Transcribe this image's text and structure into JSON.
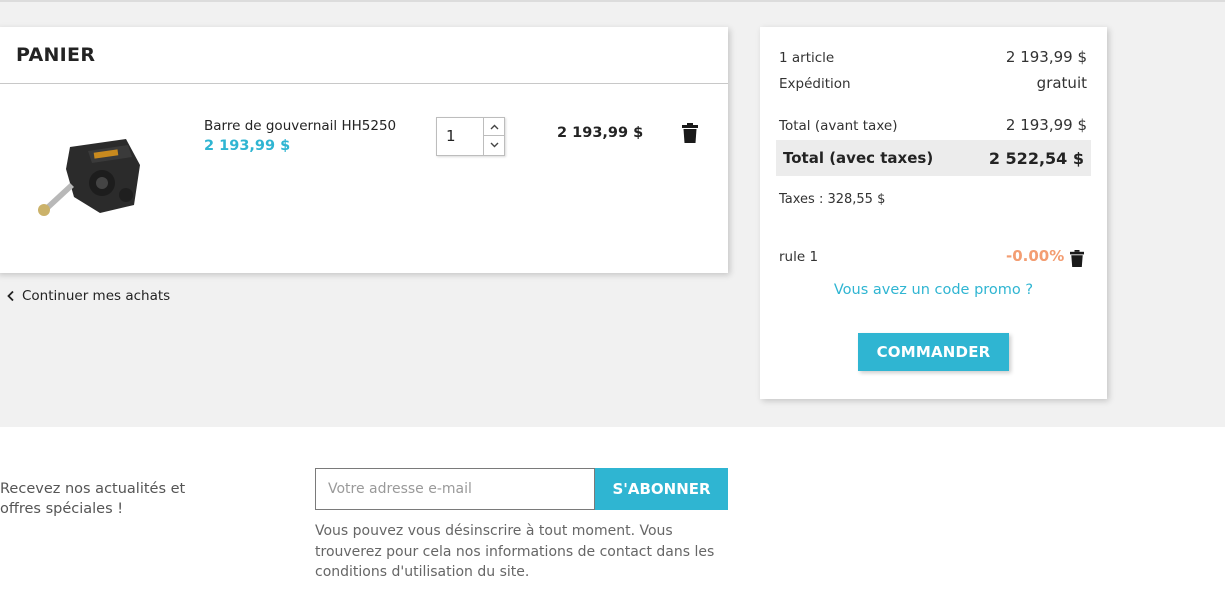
{
  "cart": {
    "title": "PANIER",
    "item": {
      "name": "Barre de gouvernail HH5250",
      "unit_price": "2 193,99 $",
      "quantity": "1",
      "line_total": "2 193,99 $"
    },
    "continue_label": "Continuer mes achats"
  },
  "summary": {
    "articles_label": "1 article",
    "articles_value": "2 193,99 $",
    "shipping_label": "Expédition",
    "shipping_value": "gratuit",
    "subtotal_label": "Total (avant taxe)",
    "subtotal_value": "2 193,99 $",
    "total_label": "Total (avec taxes)",
    "total_value": "2 522,54 $",
    "taxes_text": "Taxes : 328,55 $",
    "rule_label": "rule 1",
    "rule_value": "-0.00%",
    "promo_link": "Vous avez un code promo ?",
    "checkout_label": "COMMANDER"
  },
  "newsletter": {
    "text": "Recevez nos actualités et offres spéciales !",
    "placeholder": "Votre adresse e-mail",
    "button_label": "S'ABONNER",
    "note": "Vous pouvez vous désinscrire à tout moment. Vous trouverez pour cela nos informations de contact dans les conditions d'utilisation du site."
  },
  "icons": {
    "delete": "trash-icon",
    "back": "chevron-left-icon",
    "qty_up": "chevron-up-icon",
    "qty_down": "chevron-down-icon"
  },
  "colors": {
    "accent": "#2fb5d2",
    "discount": "#f39d72",
    "background": "#f1f1f1"
  }
}
